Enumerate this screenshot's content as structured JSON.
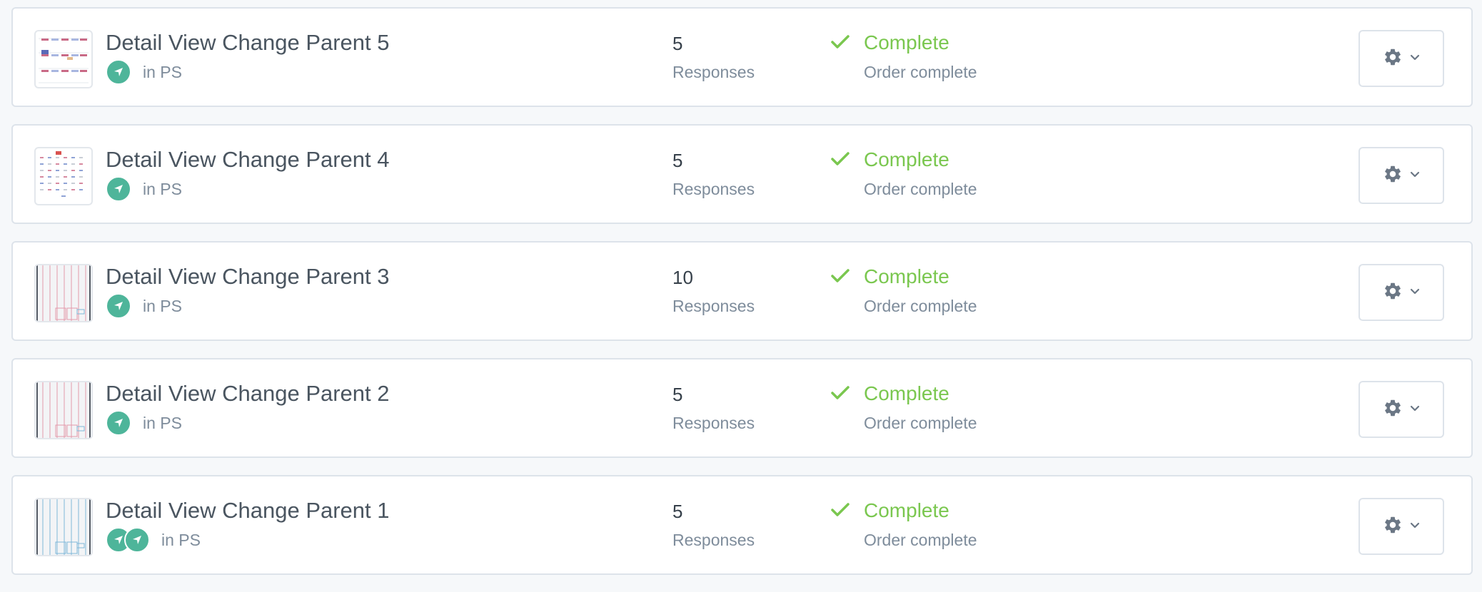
{
  "rows": [
    {
      "title": "Detail View Change Parent 5",
      "location": "in PS",
      "count": "5",
      "count_label": "Responses",
      "status": "Complete",
      "status_detail": "Order complete",
      "thumb_variant": "grid",
      "badge_count": 1
    },
    {
      "title": "Detail View Change Parent 4",
      "location": "in PS",
      "count": "5",
      "count_label": "Responses",
      "status": "Complete",
      "status_detail": "Order complete",
      "thumb_variant": "dots",
      "badge_count": 1
    },
    {
      "title": "Detail View Change Parent 3",
      "location": "in PS",
      "count": "10",
      "count_label": "Responses",
      "status": "Complete",
      "status_detail": "Order complete",
      "thumb_variant": "pink-columns",
      "badge_count": 1
    },
    {
      "title": "Detail View Change Parent 2",
      "location": "in PS",
      "count": "5",
      "count_label": "Responses",
      "status": "Complete",
      "status_detail": "Order complete",
      "thumb_variant": "pink-columns",
      "badge_count": 1
    },
    {
      "title": "Detail View Change Parent 1",
      "location": "in PS",
      "count": "5",
      "count_label": "Responses",
      "status": "Complete",
      "status_detail": "Order complete",
      "thumb_variant": "blue-columns",
      "badge_count": 2
    }
  ],
  "icons": {
    "badge": "navigation-arrow-icon",
    "status": "checkmark-icon",
    "settings": "gear-icon",
    "dropdown": "chevron-down-icon"
  },
  "colors": {
    "badge": "#4eb59a",
    "status": "#7ac74f",
    "settings_icon": "#6b7785"
  }
}
